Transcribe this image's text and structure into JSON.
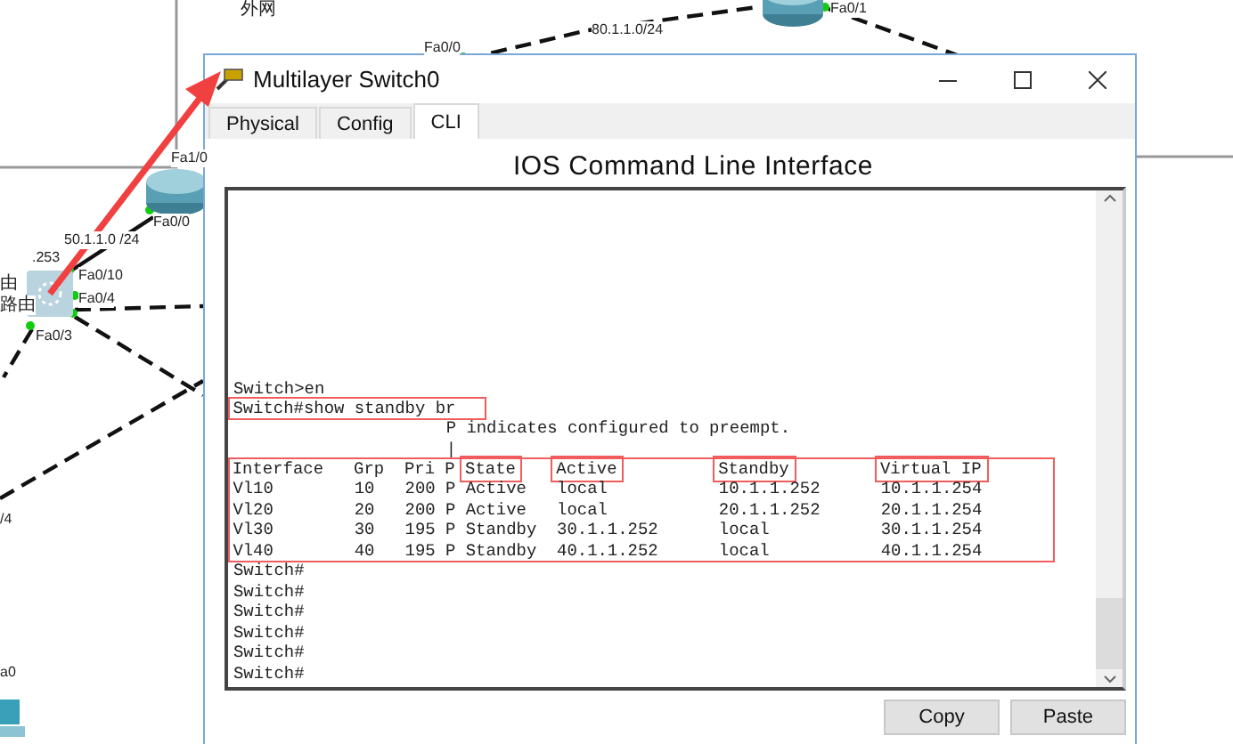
{
  "topology_labels": [
    "外网",
    "Fa0/0",
    "80.1.1.0/24",
    "Fa0/1",
    "Fa1/0",
    "Fa0/0",
    "50.1.1.0 /24",
    ".253",
    "Fa0/10",
    "Fa0/4",
    "Fa0/3",
    "由",
    "路由",
    "/4",
    "a0"
  ],
  "window": {
    "title": "Multilayer Switch0",
    "tabs": [
      {
        "label": "Physical",
        "selected": false
      },
      {
        "label": "Config",
        "selected": false
      },
      {
        "label": "CLI",
        "selected": true
      }
    ],
    "heading": "IOS Command Line Interface",
    "terminal": [
      {
        "kind": "line",
        "text": "Switch>en",
        "highlighted": false
      },
      {
        "kind": "line",
        "text": "Switch#show standby br",
        "highlighted": true
      },
      {
        "kind": "line",
        "text": "                     P indicates configured to preempt.",
        "highlighted": false
      },
      {
        "kind": "line",
        "text": "                     |",
        "highlighted": false
      },
      {
        "kind": "table",
        "highlighted": true,
        "header": [
          {
            "text": "Interface",
            "highlighted": false
          },
          {
            "text": "Grp",
            "highlighted": false
          },
          {
            "text": "Pri",
            "highlighted": false
          },
          {
            "text": "P",
            "highlighted": false
          },
          {
            "text": "State",
            "highlighted": true
          },
          {
            "text": "Active",
            "highlighted": true
          },
          {
            "text": "Standby",
            "highlighted": true
          },
          {
            "text": "Virtual IP",
            "highlighted": true
          }
        ],
        "rows": [
          "Vl10        10   200 P Active   local           10.1.1.252      10.1.1.254",
          "Vl20        20   200 P Active   local           20.1.1.252      20.1.1.254",
          "Vl30        30   195 P Standby  30.1.1.252      local           30.1.1.254",
          "Vl40        40   195 P Standby  40.1.1.252      local           40.1.1.254"
        ]
      },
      {
        "kind": "line",
        "text": "Switch#",
        "highlighted": false
      },
      {
        "kind": "line",
        "text": "Switch#",
        "highlighted": false
      },
      {
        "kind": "line",
        "text": "Switch#",
        "highlighted": false
      },
      {
        "kind": "line",
        "text": "Switch#",
        "highlighted": false
      },
      {
        "kind": "line",
        "text": "Switch#",
        "highlighted": false
      },
      {
        "kind": "line",
        "text": "Switch#",
        "highlighted": false
      }
    ],
    "buttons": [
      "Copy",
      "Paste"
    ]
  }
}
